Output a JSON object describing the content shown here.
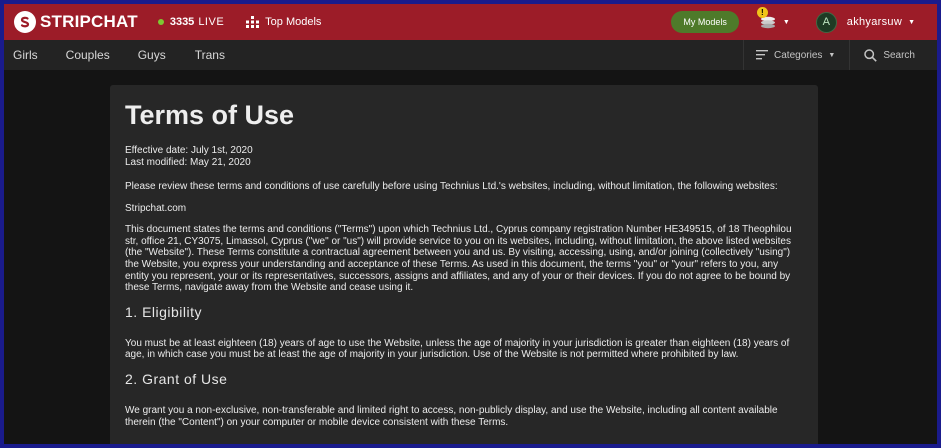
{
  "brand": {
    "name": "STRIPCHAT"
  },
  "header": {
    "live_count": "3335",
    "live_label": "LIVE",
    "top_models": "Top Models",
    "my_models": "My Models",
    "notification_badge": "!",
    "username": "akhyarsuw",
    "avatar_initial": "A"
  },
  "subnav": {
    "items": [
      {
        "label": "Girls"
      },
      {
        "label": "Couples"
      },
      {
        "label": "Guys"
      },
      {
        "label": "Trans"
      }
    ],
    "categories": "Categories",
    "search": "Search"
  },
  "document": {
    "title": "Terms of Use",
    "effective": "Effective date: July 1st, 2020",
    "modified": "Last modified: May 21, 2020",
    "intro": "Please review these terms and conditions of use carefully before using Technius Ltd.'s websites, including, without limitation, the following websites:",
    "site": "Stripchat.com",
    "statement": "This document states the terms and conditions (\"Terms\") upon which Technius Ltd., Cyprus company registration Number HE349515, of 18 Theophilou str, office 21, CY3075, Limassol, Cyprus (\"we\" or \"us\") will provide service to you on its websites, including, without limitation, the above listed websites (the \"Website\"). These Terms constitute a contractual agreement between you and us. By visiting, accessing, using, and/or joining (collectively \"using\") the Website, you express your understanding and acceptance of these Terms. As used in this document, the terms \"you\" or \"your\" refers to you, any entity you represent, your or its representatives, successors, assigns and affiliates, and any of your or their devices. If you do not agree to be bound by these Terms, navigate away from the Website and cease using it.",
    "sections": [
      {
        "title": "1. Eligibility",
        "body": "You must be at least eighteen (18) years of age to use the Website, unless the age of majority in your jurisdiction is greater than eighteen (18) years of age, in which case you must be at least the age of majority in your jurisdiction. Use of the Website is not permitted where prohibited by law."
      },
      {
        "title": "2. Grant of Use",
        "body": "We grant you a non-exclusive, non-transferable and limited right to access, non-publicly display, and use the Website, including all content available therein (the \"Content\") on your computer or mobile device consistent with these Terms."
      }
    ]
  },
  "colors": {
    "topbar": "#9c1c28",
    "live_dot": "#7ec832",
    "my_models_button": "#4e7a2a",
    "badge": "#f0c419",
    "page_background": "#141414",
    "content_panel": "#272727"
  },
  "icons": [
    "logo-icon",
    "top-models-icon",
    "notification-icon",
    "caret-down-icon",
    "hamburger-icon",
    "search-icon"
  ]
}
